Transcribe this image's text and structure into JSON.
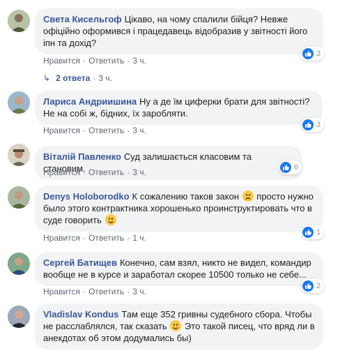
{
  "comments": [
    {
      "author": "Света Кисельгоф",
      "text": "Цікаво, на чому спалили бійця? Невже офіційно оформився і працедавець відобразив у звітності його іпн та дохід?",
      "like": "Нравится",
      "reply": "Ответить",
      "time": "3 ч.",
      "reactions": "3",
      "replies_label": "2 ответа",
      "replies_time": "3 ч."
    },
    {
      "author": "Лариса Андриишина",
      "text": "Ну а де їм циферки брати для звітності? Не на собі ж, бідних, їх заробляти.",
      "like": "Нравится",
      "reply": "Ответить",
      "time": "3 ч.",
      "reactions": "3"
    },
    {
      "author": "Віталій Павленко",
      "text": "Суд залишається класовим та становим.",
      "like": "Нравится",
      "reply": "Ответить",
      "time": "3 ч.",
      "reactions": "6"
    },
    {
      "author": "Denys Holoborodko",
      "text_a": "К сожалению таков закон",
      "text_b": "просто нужно было этого контрактника хорошенько проинструктировать что в суде говорить",
      "like": "Нравится",
      "reply": "Ответить",
      "time": "1 ч.",
      "reactions": "1"
    },
    {
      "author": "Сергей Батищев",
      "text": "Конечно, сам взял, никто не видел, командир вообще не в курсе и заработал скорее 10500 только не себе...",
      "like": "Нравится",
      "reply": "Ответить",
      "time": "3 ч.",
      "reactions": "2"
    },
    {
      "author": "Vladislav Kondus",
      "text_a": "Там еще 352 гривны судебного сбора. Чтобы не расслаблялся, так сказать",
      "text_b": "Это такой писец, что вряд ли в анекдотах об этом додумались бы)"
    }
  ],
  "colors": {
    "link": "#385898",
    "bubble": "#f2f3f5",
    "like": "#1877f2",
    "meta": "#606770"
  }
}
